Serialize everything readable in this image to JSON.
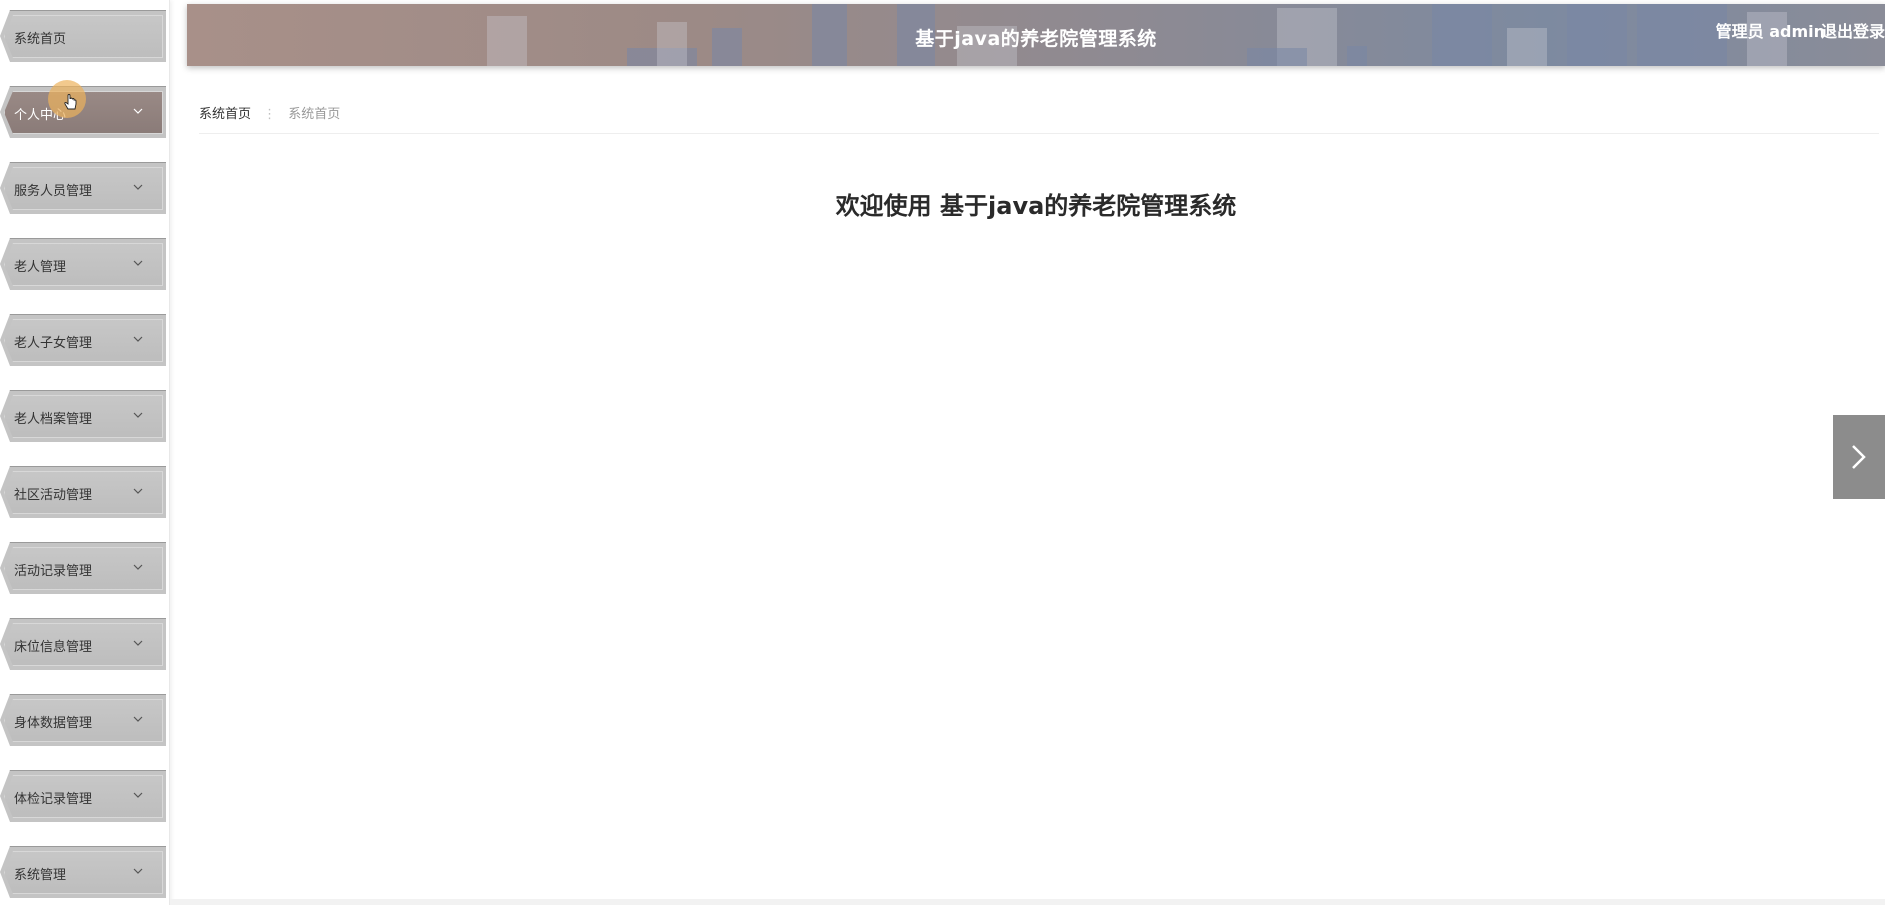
{
  "header": {
    "title": "基于java的养老院管理系统",
    "user": "管理员 admin",
    "logout": "退出登录"
  },
  "sidebar": {
    "items": [
      {
        "label": "系统首页",
        "has_arrow": false,
        "active": false
      },
      {
        "label": "个人中心",
        "has_arrow": true,
        "active": true
      },
      {
        "label": "服务人员管理",
        "has_arrow": true,
        "active": false
      },
      {
        "label": "老人管理",
        "has_arrow": true,
        "active": false
      },
      {
        "label": "老人子女管理",
        "has_arrow": true,
        "active": false
      },
      {
        "label": "老人档案管理",
        "has_arrow": true,
        "active": false
      },
      {
        "label": "社区活动管理",
        "has_arrow": true,
        "active": false
      },
      {
        "label": "活动记录管理",
        "has_arrow": true,
        "active": false
      },
      {
        "label": "床位信息管理",
        "has_arrow": true,
        "active": false
      },
      {
        "label": "身体数据管理",
        "has_arrow": true,
        "active": false
      },
      {
        "label": "体检记录管理",
        "has_arrow": true,
        "active": false
      },
      {
        "label": "系统管理",
        "has_arrow": true,
        "active": false
      }
    ]
  },
  "breadcrumb": {
    "home": "系统首页",
    "separator": "⋮",
    "current": "系统首页"
  },
  "main": {
    "welcome": "欢迎使用 基于java的养老院管理系统"
  },
  "icons": {
    "chevron": "chevron-down-icon",
    "next": "chevron-right-icon"
  }
}
